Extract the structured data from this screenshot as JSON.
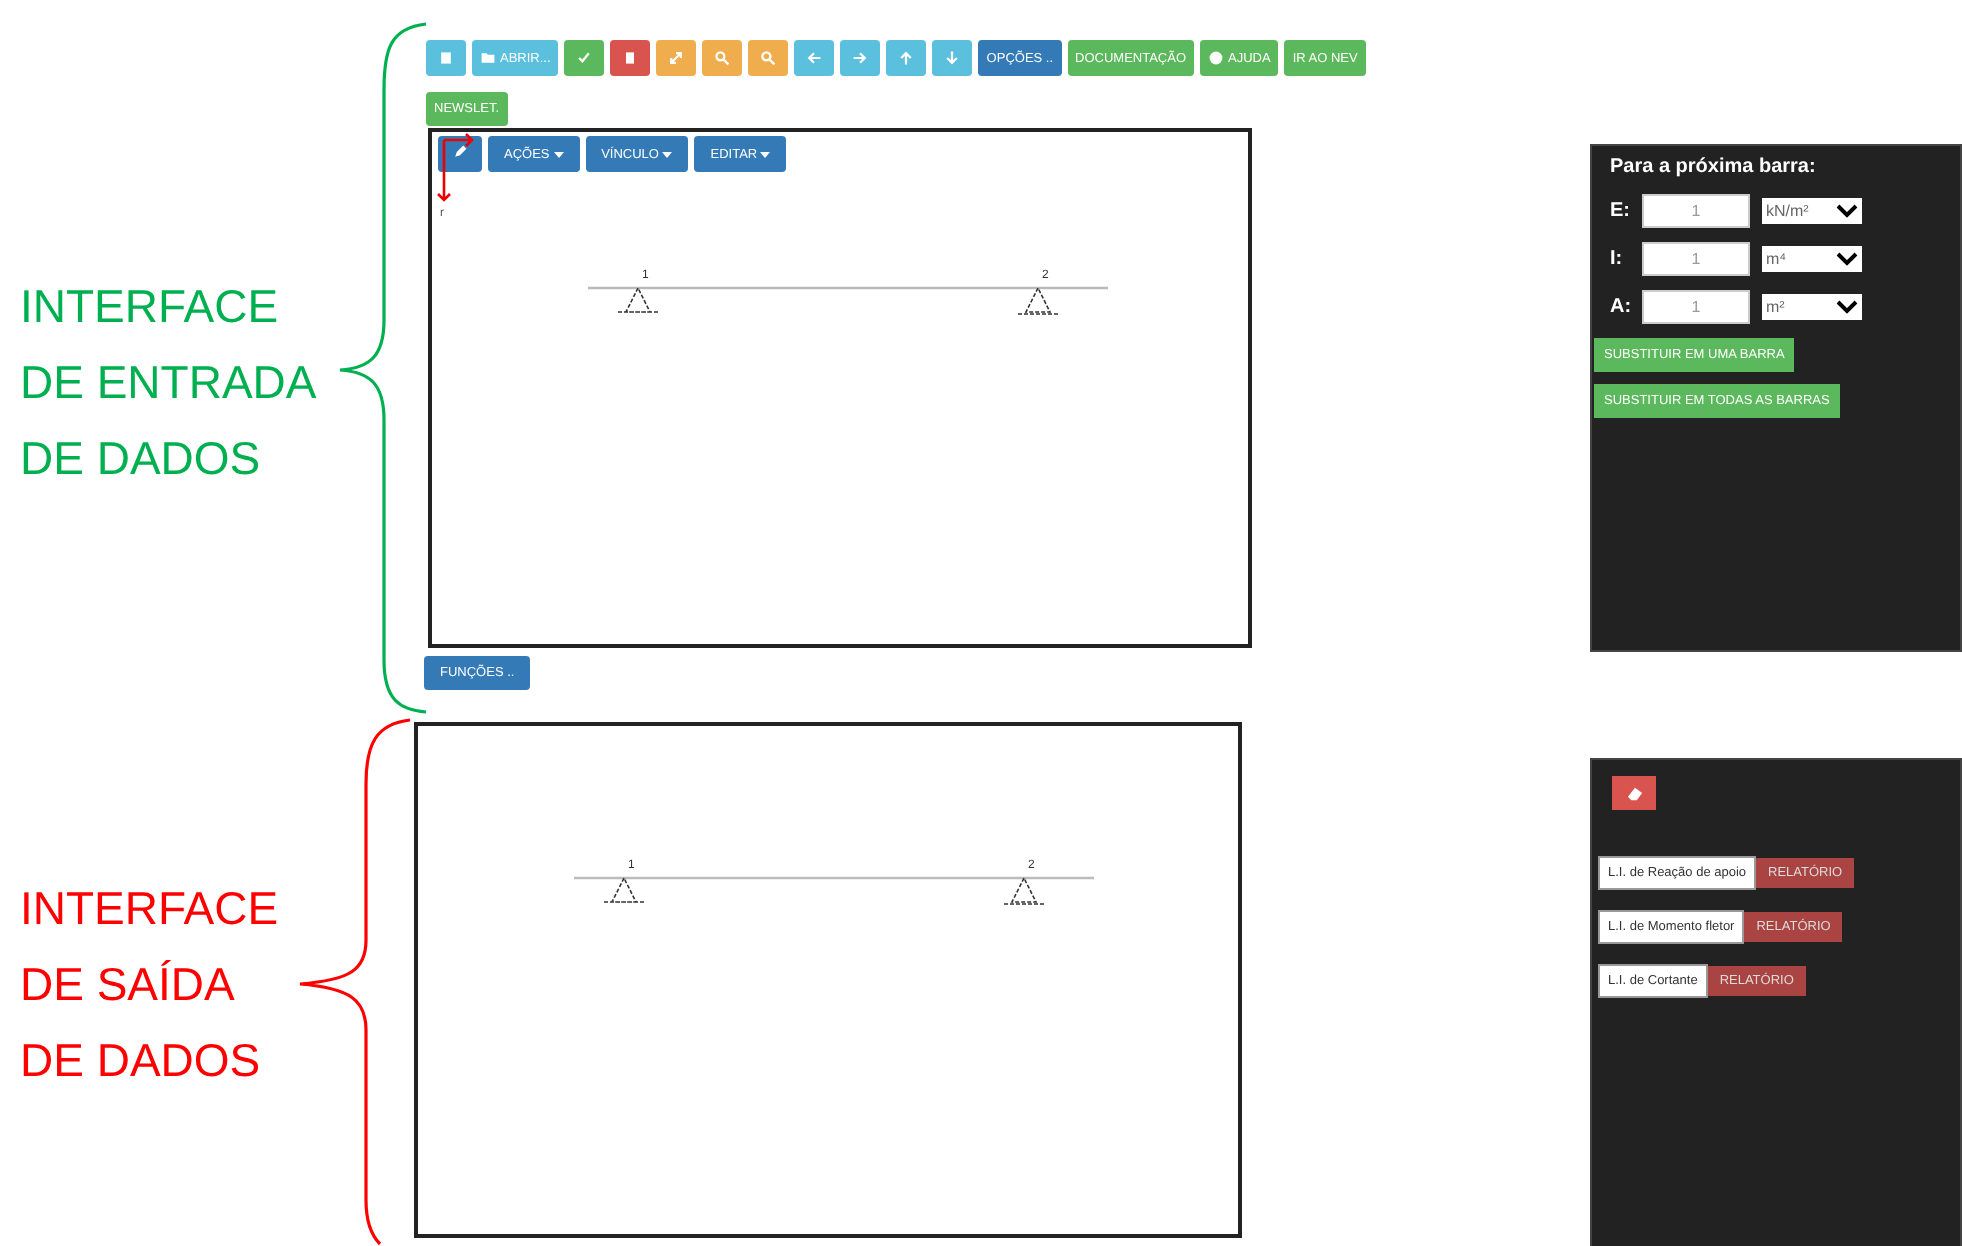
{
  "annotations": [
    {
      "kind": "input",
      "lines": [
        "INTERFACE",
        "DE ENTRADA",
        "DE DADOS"
      ],
      "color": "#00b050"
    },
    {
      "kind": "output",
      "lines": [
        "INTERFACE",
        "DE SAÍDA",
        "DE DADOS"
      ],
      "color": "#ff0000"
    }
  ],
  "toolbar": [
    {
      "kind": "info"
    },
    {
      "kind": "info",
      "label": "ABRIR..."
    },
    {
      "kind": "success"
    },
    {
      "kind": "danger"
    },
    {
      "kind": "warning"
    },
    {
      "kind": "warning"
    },
    {
      "kind": "warning"
    },
    {
      "kind": "info"
    },
    {
      "kind": "info"
    },
    {
      "kind": "info"
    },
    {
      "kind": "info"
    },
    {
      "kind": "primary",
      "label": "OPÇÕES .."
    },
    {
      "kind": "success",
      "label": "DOCUMENTAÇÃO"
    },
    {
      "kind": "success",
      "label": "AJUDA"
    },
    {
      "kind": "success",
      "label": "IR AO NEV"
    }
  ],
  "newsletter_button": "NEWSLET.",
  "editor": {
    "menus": [
      "AÇÕES",
      "VÍNCULO",
      "EDITAR"
    ],
    "axis_label": "r",
    "nodes": [
      "1",
      "2"
    ]
  },
  "functions_button": "FUNÇÕES ..",
  "output": {
    "nodes": [
      "1",
      "2"
    ]
  },
  "properties": {
    "title": "Para a próxima barra:",
    "rows": [
      {
        "label": "E:",
        "placeholder": "1",
        "unit": "kN/m²"
      },
      {
        "label": "I:",
        "placeholder": "1",
        "unit": "m⁴"
      },
      {
        "label": "A:",
        "placeholder": "1",
        "unit": "m²"
      }
    ],
    "buttons": [
      "SUBSTITUIR EM UMA BARRA",
      "SUBSTITUIR EM TODAS AS BARRAS"
    ]
  },
  "results": {
    "rows": [
      {
        "value": "L.I. de Reação de apoio",
        "button": "RELATÓRIO"
      },
      {
        "value": "L.I. de Momento fletor",
        "button": "RELATÓRIO"
      },
      {
        "value": "L.I. de Cortante",
        "button": "RELATÓRIO"
      }
    ]
  }
}
